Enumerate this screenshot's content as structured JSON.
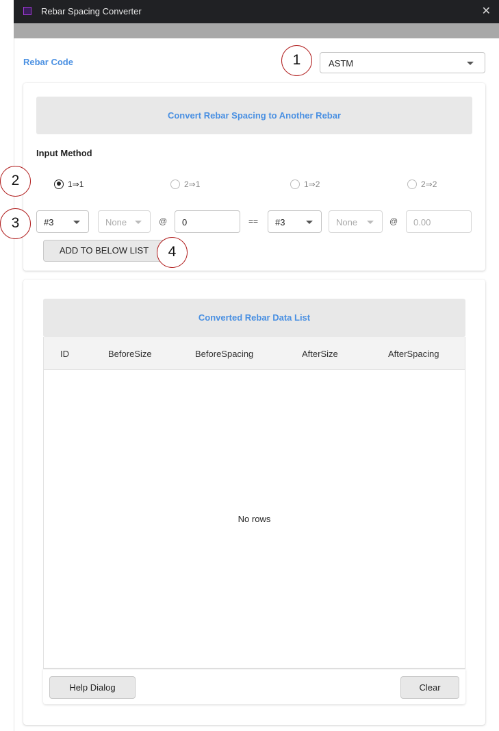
{
  "window": {
    "title": "Rebar Spacing Converter",
    "close_glyph": "✕"
  },
  "rebar_code": {
    "label": "Rebar Code",
    "selected": "ASTM"
  },
  "converter": {
    "header": "Convert Rebar Spacing to Another Rebar",
    "input_method_label": "Input Method",
    "methods": [
      {
        "label": "1⇒1",
        "checked": true
      },
      {
        "label": "2⇒1",
        "checked": false
      },
      {
        "label": "1⇒2",
        "checked": false
      },
      {
        "label": "2⇒2",
        "checked": false
      }
    ],
    "before_size": "#3",
    "before_size2": "None",
    "at_symbol": "@",
    "before_spacing": "0",
    "equals_symbol": "==",
    "after_size": "#3",
    "after_size2": "None",
    "after_spacing_placeholder": "0.00",
    "add_button": "ADD TO BELOW LIST"
  },
  "data_list": {
    "header": "Converted Rebar Data List",
    "columns": [
      "ID",
      "BeforeSize",
      "BeforeSpacing",
      "AfterSize",
      "AfterSpacing"
    ],
    "empty_text": "No rows",
    "help_button": "Help Dialog",
    "clear_button": "Clear"
  },
  "callouts": [
    "1",
    "2",
    "3",
    "4"
  ],
  "colors": {
    "accent": "#4a90e2",
    "callout_border": "#b01c1c",
    "titlebar": "#202124"
  }
}
